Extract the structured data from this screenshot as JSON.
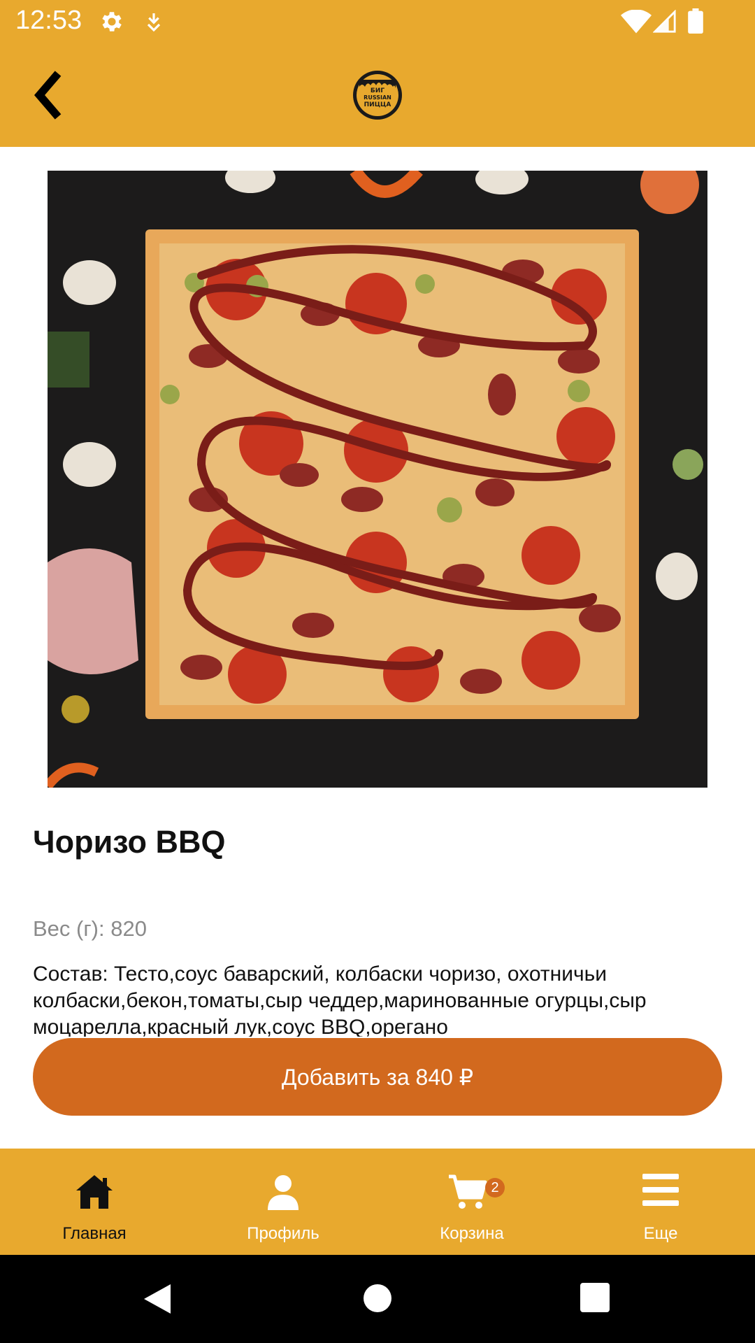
{
  "status_bar": {
    "time": "12:53"
  },
  "app_bar": {
    "logo_text": [
      "БИГ",
      "RUSSIAN",
      "ПИЦЦА"
    ]
  },
  "product": {
    "title": "Чоризо BBQ",
    "weight": "Вес (г): 820",
    "composition": "Состав: Тесто,соус баварский, колбаски чоризо, охотничьи колбаски,бекон,томаты,сыр чеддер,маринованные огурцы,сыр моцарелла,красный лук,соус BBQ,орегано",
    "add_button_label": "Добавить за 840 ₽"
  },
  "bottom_nav": {
    "items": [
      {
        "label": "Главная",
        "icon": "home-icon",
        "active": true
      },
      {
        "label": "Профиль",
        "icon": "profile-icon",
        "active": false
      },
      {
        "label": "Корзина",
        "icon": "cart-icon",
        "active": false,
        "badge": "2"
      },
      {
        "label": "Еще",
        "icon": "menu-icon",
        "active": false
      }
    ]
  },
  "colors": {
    "brand_yellow": "#E8A92E",
    "accent_orange": "#D2691E"
  }
}
